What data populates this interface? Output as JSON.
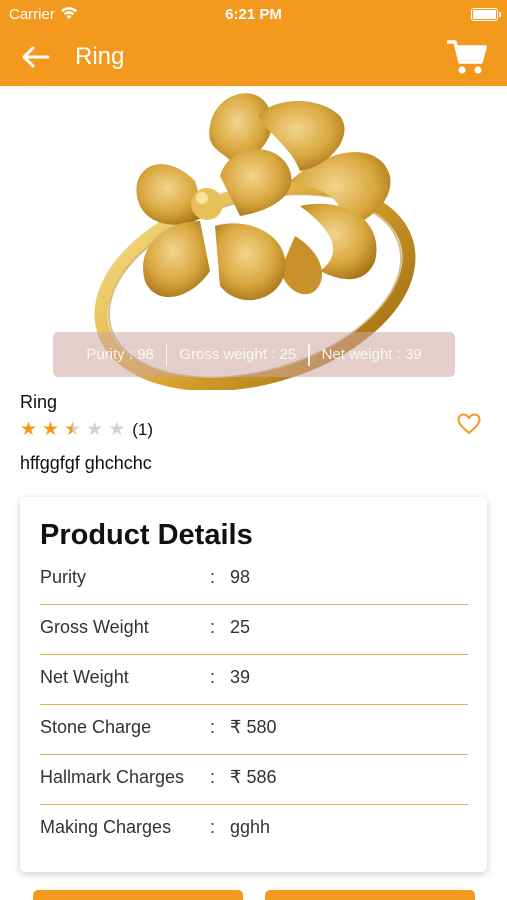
{
  "status_bar": {
    "carrier": "Carrier",
    "time": "6:21 PM"
  },
  "nav": {
    "title": "Ring",
    "back_icon": "arrow-left-icon",
    "cart_icon": "shopping-cart-icon"
  },
  "hero": {
    "image": "gold-flower-ring",
    "specs": {
      "purity": "Purity : 98",
      "gross_weight": "Gross weight : 25",
      "net_weight": "Net weight : 39"
    }
  },
  "product": {
    "name": "Ring",
    "rating": 2.5,
    "rating_max": 5,
    "review_count": "(1)",
    "description": "hffggfgf ghchchc",
    "wishlist_icon": "heart-outline-icon"
  },
  "details": {
    "title": "Product Details",
    "rows": [
      {
        "label": "Purity",
        "colon": ":",
        "value": "98"
      },
      {
        "label": "Gross Weight",
        "colon": ":",
        "value": "25"
      },
      {
        "label": "Net Weight",
        "colon": ":",
        "value": "39"
      },
      {
        "label": "Stone Charge",
        "colon": ":",
        "value": "₹ 580"
      },
      {
        "label": "Hallmark Charges",
        "colon": ":",
        "value": "₹ 586"
      },
      {
        "label": "Making Charges",
        "colon": ":",
        "value": "gghh"
      }
    ]
  },
  "colors": {
    "accent": "#F39A1E",
    "divider": "#E4B25A",
    "gold": "#D9A42C"
  }
}
